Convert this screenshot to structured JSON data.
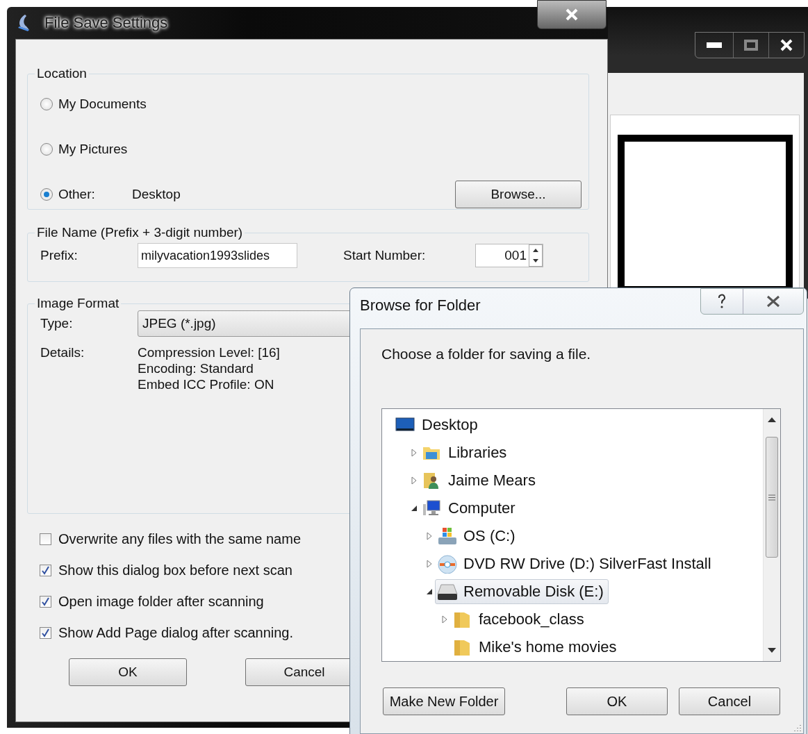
{
  "file_save_dialog": {
    "title": "File Save Settings",
    "location": {
      "label": "Location",
      "options": [
        {
          "label": "My Documents",
          "selected": false
        },
        {
          "label": "My Pictures",
          "selected": false
        },
        {
          "label": "Other:",
          "selected": true,
          "value": "Desktop"
        }
      ],
      "browse_button": "Browse..."
    },
    "file_name": {
      "label": "File Name (Prefix + 3-digit number)",
      "prefix_label": "Prefix:",
      "prefix_value": "milyvacation1993slides",
      "start_label": "Start Number:",
      "start_value": "001"
    },
    "image_format": {
      "label": "Image Format",
      "type_label": "Type:",
      "type_value": "JPEG (*.jpg)",
      "details_label": "Details:",
      "details": [
        "Compression Level: [16]",
        "Encoding: Standard",
        "Embed ICC Profile: ON"
      ]
    },
    "options": [
      {
        "label": "Overwrite any files with the same name",
        "checked": false
      },
      {
        "label": "Show this dialog box before next scan",
        "checked": true
      },
      {
        "label": "Open image folder after scanning",
        "checked": true
      },
      {
        "label": "Show Add Page dialog after scanning.",
        "checked": true
      }
    ],
    "buttons": [
      "OK",
      "Cancel"
    ]
  },
  "browse_dialog": {
    "title": "Browse for Folder",
    "instruction": "Choose a folder for saving a file.",
    "tree": [
      {
        "label": "Desktop",
        "kind": "desktop",
        "expandable": false,
        "selected": false,
        "children": [
          {
            "label": "Libraries",
            "kind": "libraries",
            "expandable": true,
            "expanded": false,
            "selected": false
          },
          {
            "label": "Jaime Mears",
            "kind": "user",
            "expandable": true,
            "expanded": false,
            "selected": false
          },
          {
            "label": "Computer",
            "kind": "computer",
            "expandable": true,
            "expanded": true,
            "selected": false,
            "children": [
              {
                "label": "OS (C:)",
                "kind": "system-drive",
                "expandable": true,
                "expanded": false,
                "selected": false
              },
              {
                "label": "DVD RW Drive (D:) SilverFast Install",
                "kind": "disc",
                "expandable": true,
                "expanded": false,
                "selected": false
              },
              {
                "label": "Removable Disk (E:)",
                "kind": "removable",
                "expandable": true,
                "expanded": true,
                "selected": true,
                "children": [
                  {
                    "label": "facebook_class",
                    "kind": "folder",
                    "expandable": true,
                    "expanded": false,
                    "selected": false
                  },
                  {
                    "label": "Mike's home movies",
                    "kind": "folder",
                    "expandable": false,
                    "selected": false
                  }
                ]
              }
            ]
          }
        ]
      }
    ],
    "buttons": [
      "Make New Folder",
      "OK",
      "Cancel"
    ]
  }
}
